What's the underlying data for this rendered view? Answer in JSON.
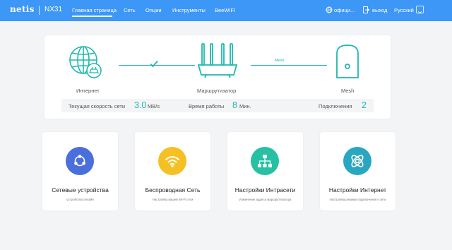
{
  "header": {
    "logo": "netis",
    "model": "NX31",
    "nav": [
      "Главная страница",
      "Сеть",
      "Опции",
      "Инструменты",
      "BeeWIFI"
    ],
    "right": {
      "site_label": "офици...",
      "logout_label": "выход",
      "language": "Русский"
    }
  },
  "topology": {
    "internet_label": "Интернет",
    "router_label": "Маршрутизатор",
    "mesh_label": "Mesh",
    "mesh_link_label": "Mesh"
  },
  "stats": {
    "speed_label": "Текущая скорость сети",
    "speed_value": "3.0",
    "speed_unit": "MB/s",
    "uptime_label": "Время работы",
    "uptime_value": "8",
    "uptime_unit": "Мин.",
    "connections_label": "Подключения",
    "connections_value": "2"
  },
  "features": [
    {
      "title": "Сетевые устройства",
      "subtitle": "устройства онлайн",
      "icon": "network-devices-icon",
      "color": "#4a6fdc"
    },
    {
      "title": "Беспроводная Сеть",
      "subtitle": "Настройка вашей Wi-Fi сети",
      "icon": "wifi-icon",
      "color": "#f5c023"
    },
    {
      "title": "Настройки Интрасети",
      "subtitle": "Изменение адреса маршрутизатора",
      "icon": "lan-topology-icon",
      "color": "#26c0a2"
    },
    {
      "title": "Настройки Интернет",
      "subtitle": "Настройка режима подключения к сети",
      "icon": "internet-settings-icon",
      "color": "#2aa7c0"
    }
  ],
  "colors": {
    "header_bg": "#3d97f6",
    "accent": "#1fb8ae"
  }
}
